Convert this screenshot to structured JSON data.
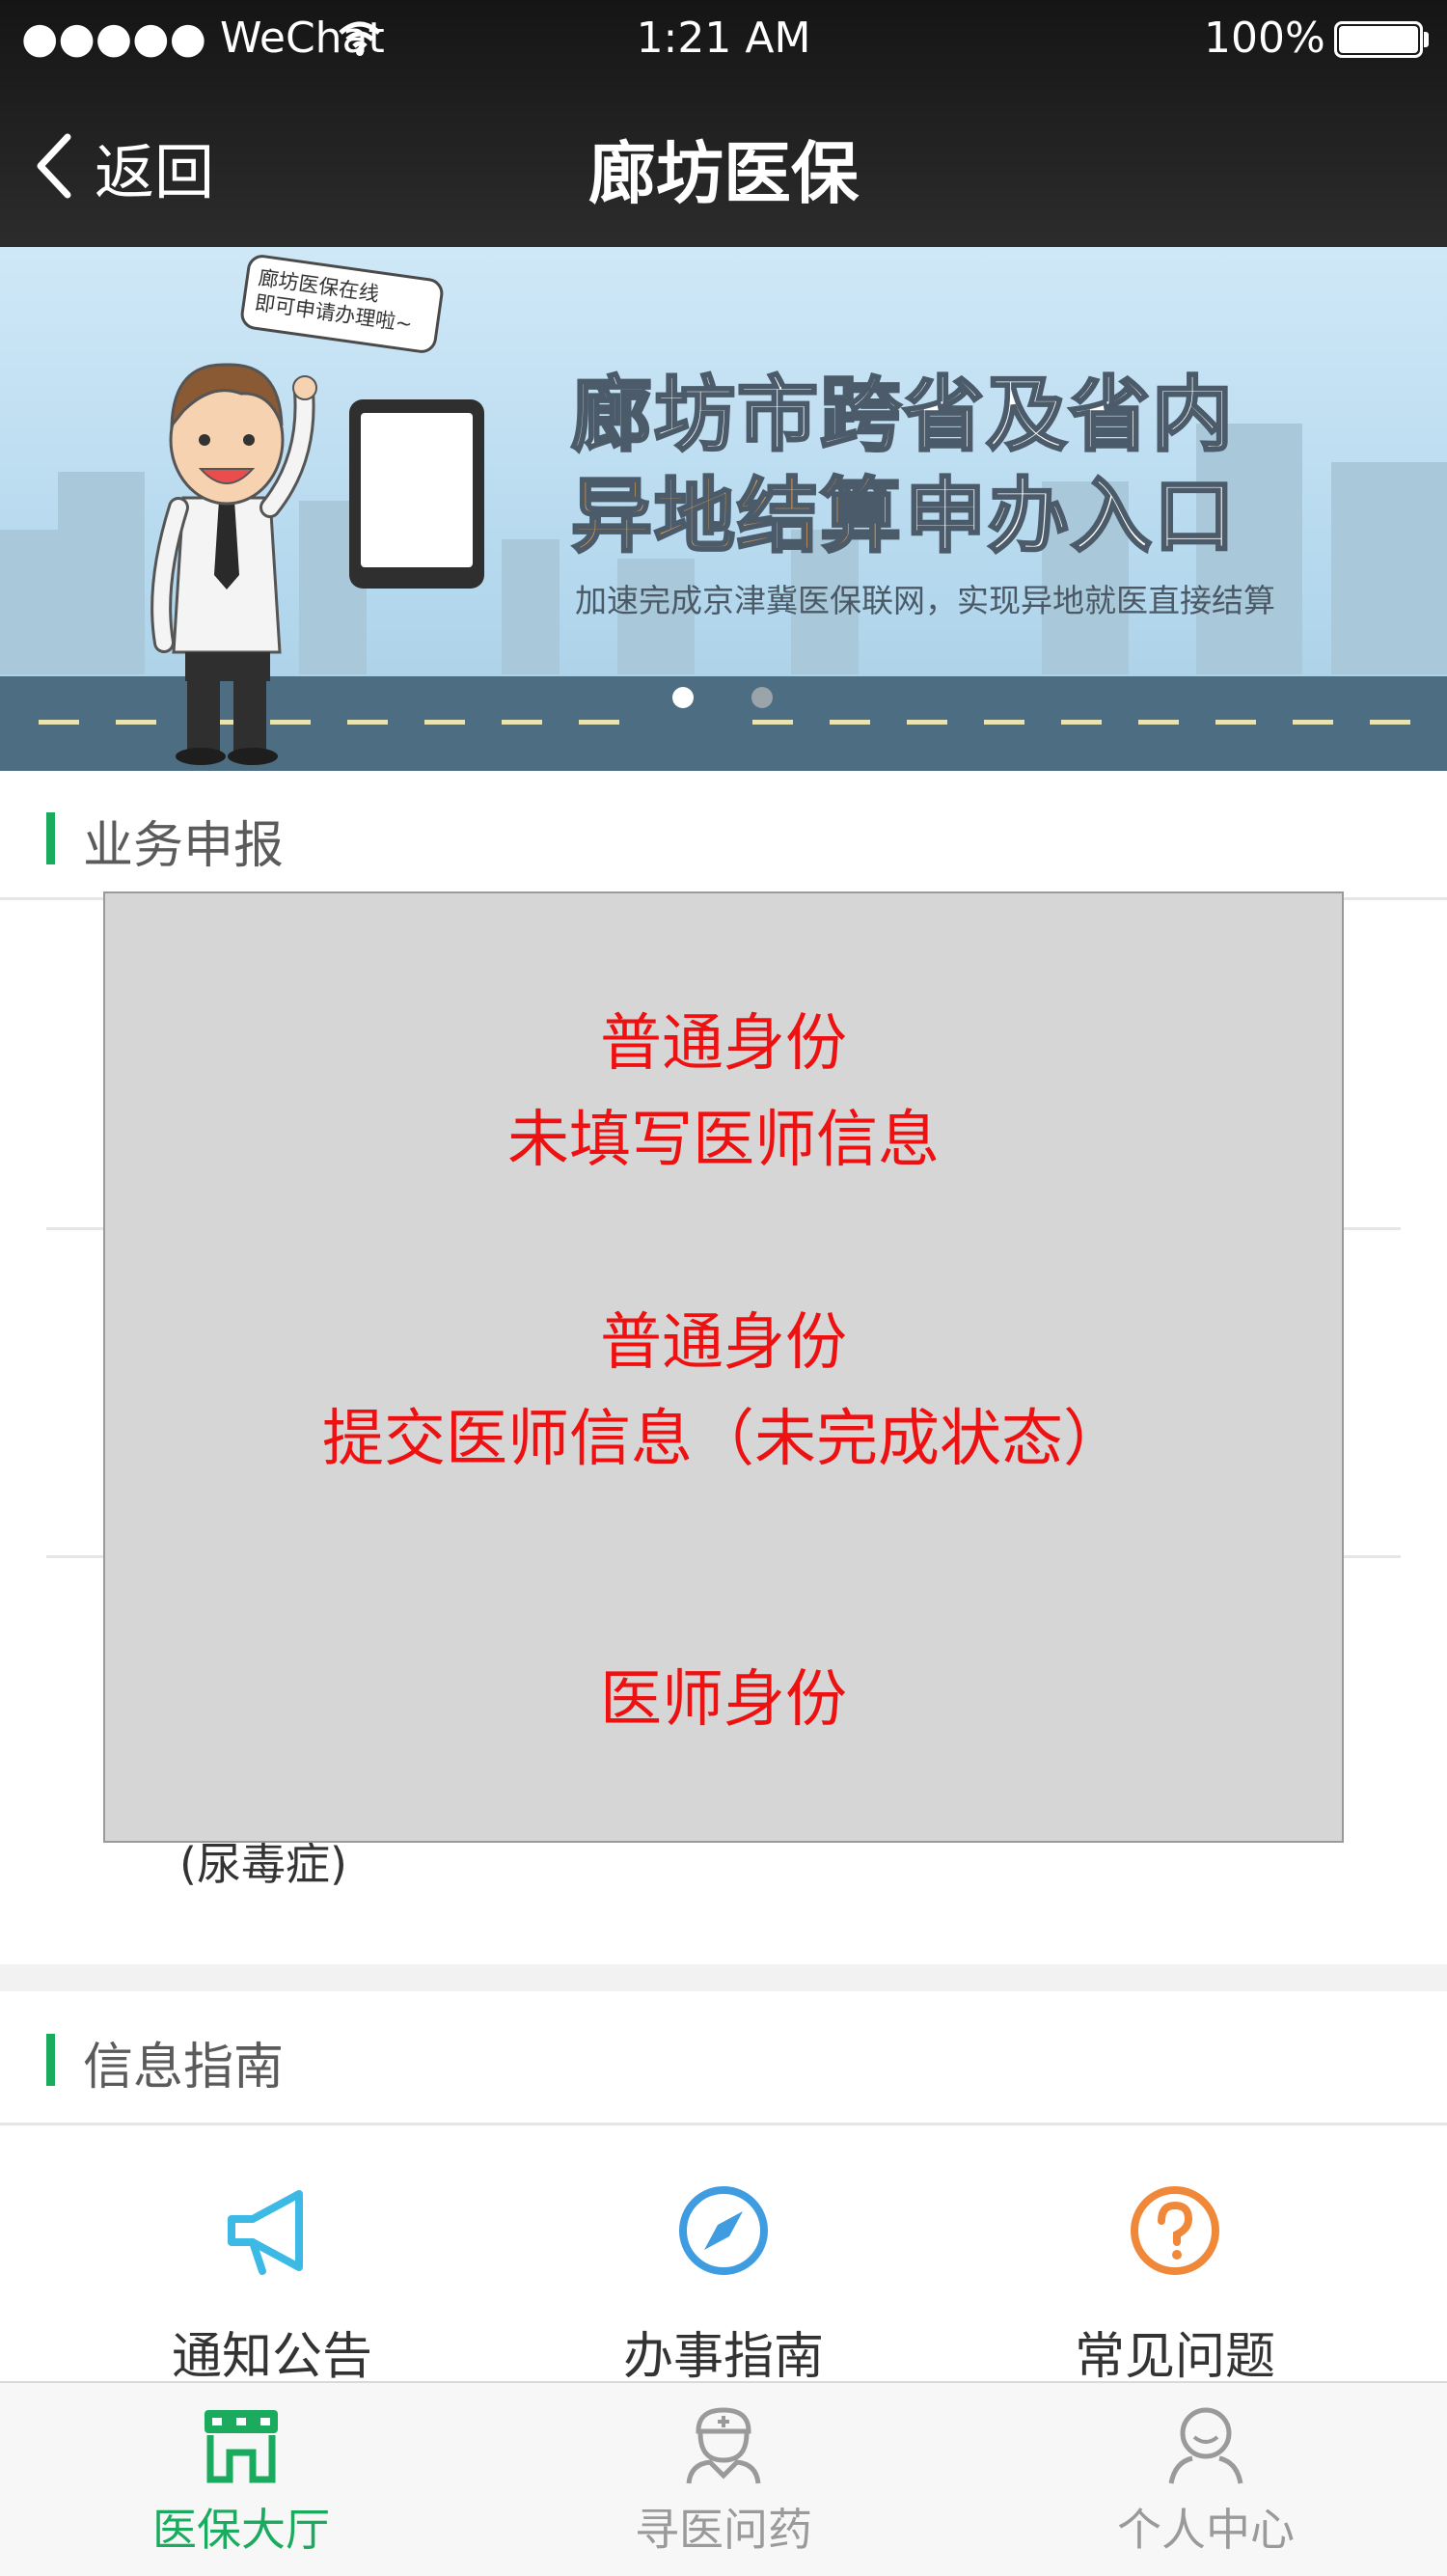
{
  "status_bar": {
    "carrier": "●●●●● WeChat",
    "time": "1:21 AM",
    "battery": "100%"
  },
  "nav": {
    "back_label": "返回",
    "title": "廊坊医保"
  },
  "banner": {
    "bubble_line1": "廊坊医保在线",
    "bubble_line2": "即可申请办理啦~",
    "title_line1": "廊坊市跨省及省内",
    "title_line2_highlight": "异地结算",
    "title_line2_rest": "申办入口",
    "subtitle": "加速完成京津冀医保联网，实现异地就医直接结算",
    "active_slide": 1,
    "slide_count": 2
  },
  "business": {
    "title": "业务申报",
    "partial_item_text": "(尿毒症)"
  },
  "overlay": {
    "line1": "普通身份",
    "line2": "未填写医师信息",
    "line3": "普通身份",
    "line4": "提交医师信息（未完成状态）",
    "line5": "医师身份"
  },
  "guide": {
    "title": "信息指南",
    "items": [
      {
        "label": "通知公告",
        "icon": "megaphone-icon",
        "color": "#3cb9e4"
      },
      {
        "label": "办事指南",
        "icon": "compass-icon",
        "color": "#3f9ce0"
      },
      {
        "label": "常见问题",
        "icon": "question-icon",
        "color": "#f0883a"
      }
    ]
  },
  "tabbar": {
    "items": [
      {
        "label": "医保大厅",
        "icon": "hall-icon",
        "active": true
      },
      {
        "label": "寻医问药",
        "icon": "doctor-icon",
        "active": false
      },
      {
        "label": "个人中心",
        "icon": "user-icon",
        "active": false
      }
    ],
    "active_color": "#1aab5f",
    "inactive_color": "#9a9a9a"
  }
}
